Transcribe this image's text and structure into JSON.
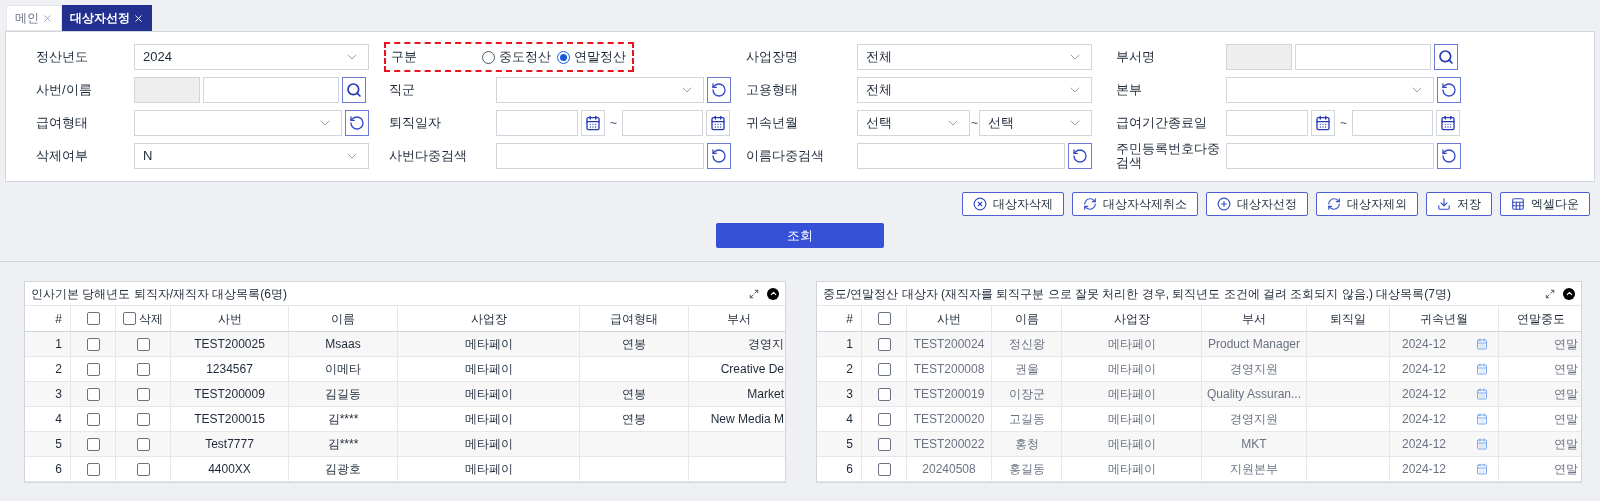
{
  "tabs": [
    {
      "label": "메인",
      "selected": false
    },
    {
      "label": "대상자선정",
      "selected": true
    }
  ],
  "filters": [
    [
      {
        "kind": "select",
        "label": "정산년도",
        "value": "2024"
      },
      {
        "kind": "radio",
        "label": "구분",
        "highlighted": true,
        "options": [
          {
            "label": "중도정산",
            "selected": false
          },
          {
            "label": "연말정산",
            "selected": true
          }
        ]
      },
      {
        "kind": "select",
        "label": "사업장명",
        "value": "전체"
      },
      {
        "kind": "code_search",
        "label": "부서명"
      }
    ],
    [
      {
        "kind": "code_search",
        "label": "사번/이름"
      },
      {
        "kind": "select_reset",
        "label": "직군"
      },
      {
        "kind": "select",
        "label": "고용형태",
        "value": "전체"
      },
      {
        "kind": "select_reset",
        "label": "본부"
      }
    ],
    [
      {
        "kind": "select_reset",
        "label": "급여형태"
      },
      {
        "kind": "date_range",
        "label": "퇴직일자",
        "separator": "~"
      },
      {
        "kind": "month_range",
        "label": "귀속년월",
        "from": "선택",
        "separator": "~",
        "to": "선택"
      },
      {
        "kind": "date_range",
        "label": "급여기간종료일",
        "separator": "~"
      }
    ],
    [
      {
        "kind": "select",
        "label": "삭제여부",
        "value": "N"
      },
      {
        "kind": "text_reset",
        "label": "사번다중검색"
      },
      {
        "kind": "text_reset",
        "label": "이름다중검색"
      },
      {
        "kind": "text_reset",
        "label": "주민등록번호다중검색"
      }
    ]
  ],
  "actions": [
    {
      "kind": "delete",
      "label": "대상자삭제"
    },
    {
      "kind": "undo",
      "label": "대상자삭제취소"
    },
    {
      "kind": "add",
      "label": "대상자선정"
    },
    {
      "kind": "undo",
      "label": "대상자제외"
    },
    {
      "kind": "save",
      "label": "저장"
    },
    {
      "kind": "excel",
      "label": "엑셀다운"
    }
  ],
  "search_button": {
    "label": "조회"
  },
  "left_table": {
    "title": "인사기본 당해년도 퇴직자/재직자 대상목록(6명)",
    "columns": [
      {
        "kind": "text",
        "label": "#"
      },
      {
        "kind": "checkbox",
        "checked": false
      },
      {
        "kind": "checkbox",
        "label": "삭제",
        "checked": false
      },
      {
        "kind": "text",
        "label": "사번"
      },
      {
        "kind": "text",
        "label": "이름"
      },
      {
        "kind": "text",
        "label": "사업장"
      },
      {
        "kind": "text",
        "label": "급여형태"
      },
      {
        "kind": "text",
        "label": "부서"
      }
    ],
    "rows": [
      {
        "cells": [
          "1",
          {
            "checked": false
          },
          {
            "checked": false
          },
          "TEST200025",
          "Msaas",
          "메타페이",
          "연봉",
          "경영지"
        ]
      },
      {
        "cells": [
          "2",
          {
            "checked": false
          },
          {
            "checked": false
          },
          "1234567",
          "이메타",
          "메타페이",
          "",
          "Creative De"
        ]
      },
      {
        "cells": [
          "3",
          {
            "checked": false
          },
          {
            "checked": false
          },
          "TEST200009",
          "김길동",
          "메타페이",
          "연봉",
          "Market"
        ]
      },
      {
        "cells": [
          "4",
          {
            "checked": false
          },
          {
            "checked": false
          },
          "TEST200015",
          "김****",
          "메타페이",
          "연봉",
          "New Media M"
        ]
      },
      {
        "cells": [
          "5",
          {
            "checked": false
          },
          {
            "checked": false
          },
          "Test7777",
          "김****",
          "메타페이",
          "",
          ""
        ]
      },
      {
        "cells": [
          "6",
          {
            "checked": false
          },
          {
            "checked": false
          },
          "4400XX",
          "김광호",
          "메타페이",
          "",
          ""
        ]
      }
    ]
  },
  "right_table": {
    "title": "중도/연말정산 대상자 (재직자를 퇴직구분 으로 잘못 처리한 경우, 퇴직년도 조건에 걸려 조회되지 않음.) 대상목록(7명)",
    "columns": [
      {
        "kind": "text",
        "label": "#"
      },
      {
        "kind": "checkbox",
        "checked": false
      },
      {
        "kind": "text",
        "label": "사번"
      },
      {
        "kind": "text",
        "label": "이름"
      },
      {
        "kind": "text",
        "label": "사업장"
      },
      {
        "kind": "text",
        "label": "부서"
      },
      {
        "kind": "text",
        "label": "퇴직일"
      },
      {
        "kind": "month",
        "label": "귀속년월"
      },
      {
        "kind": "text",
        "label": "연말중도"
      }
    ],
    "rows": [
      {
        "cells": [
          "1",
          {
            "checked": false
          },
          "TEST200024",
          "정신왕",
          "메타페이",
          "Product Manager",
          "",
          "2024-12",
          "연말"
        ]
      },
      {
        "cells": [
          "2",
          {
            "checked": false
          },
          "TEST200008",
          "권울",
          "메타페이",
          "경영지원",
          "",
          "2024-12",
          "연말"
        ]
      },
      {
        "cells": [
          "3",
          {
            "checked": false
          },
          "TEST200019",
          "이장군",
          "메타페이",
          "Quality Assuran...",
          "",
          "2024-12",
          "연말"
        ]
      },
      {
        "cells": [
          "4",
          {
            "checked": false
          },
          "TEST200020",
          "고길동",
          "메타페이",
          "경영지원",
          "",
          "2024-12",
          "연말"
        ]
      },
      {
        "cells": [
          "5",
          {
            "checked": false
          },
          "TEST200022",
          "홍청",
          "메타페이",
          "MKT",
          "",
          "2024-12",
          "연말"
        ]
      },
      {
        "cells": [
          "6",
          {
            "checked": false
          },
          "20240508",
          "홍길동",
          "메타페이",
          "지원본부",
          "",
          "2024-12",
          "연말"
        ]
      }
    ]
  }
}
